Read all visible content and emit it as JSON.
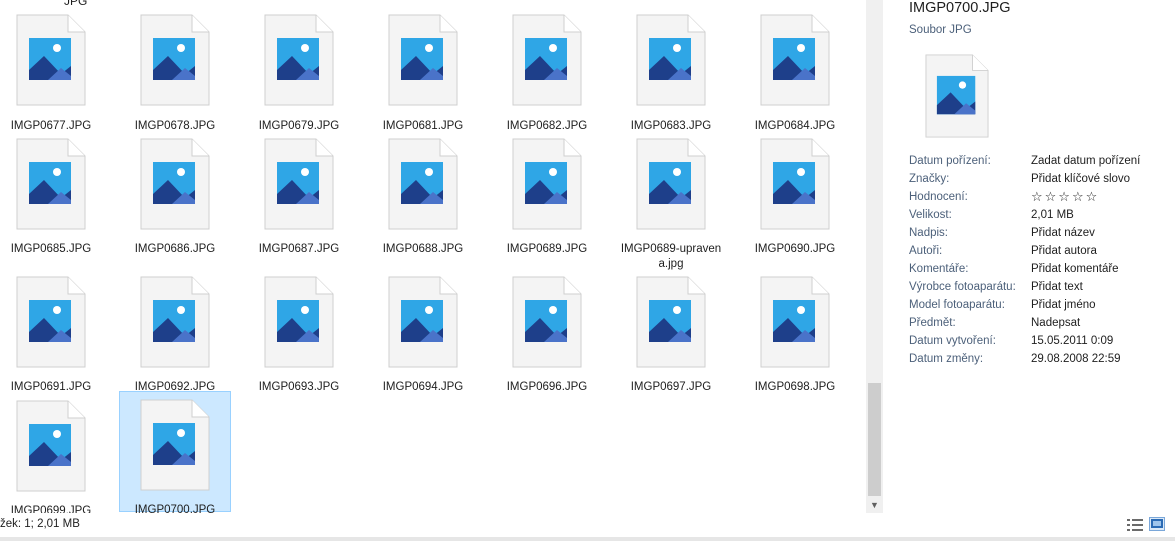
{
  "files": {
    "top_partial_label": "JPG",
    "items": [
      {
        "name": "IMGP0677.JPG",
        "selected": false
      },
      {
        "name": "IMGP0678.JPG",
        "selected": false
      },
      {
        "name": "IMGP0679.JPG",
        "selected": false
      },
      {
        "name": "IMGP0681.JPG",
        "selected": false
      },
      {
        "name": "IMGP0682.JPG",
        "selected": false
      },
      {
        "name": "IMGP0683.JPG",
        "selected": false
      },
      {
        "name": "IMGP0684.JPG",
        "selected": false
      },
      {
        "name": "IMGP0685.JPG",
        "selected": false
      },
      {
        "name": "IMGP0686.JPG",
        "selected": false
      },
      {
        "name": "IMGP0687.JPG",
        "selected": false
      },
      {
        "name": "IMGP0688.JPG",
        "selected": false
      },
      {
        "name": "IMGP0689.JPG",
        "selected": false
      },
      {
        "name": "IMGP0689-upravena.jpg",
        "selected": false
      },
      {
        "name": "IMGP0690.JPG",
        "selected": false
      },
      {
        "name": "IMGP0691.JPG",
        "selected": false
      },
      {
        "name": "IMGP0692.JPG",
        "selected": false
      },
      {
        "name": "IMGP0693.JPG",
        "selected": false
      },
      {
        "name": "IMGP0694.JPG",
        "selected": false
      },
      {
        "name": "IMGP0696.JPG",
        "selected": false
      },
      {
        "name": "IMGP0697.JPG",
        "selected": false
      },
      {
        "name": "IMGP0698.JPG",
        "selected": false
      },
      {
        "name": "IMGP0699.JPG",
        "selected": false
      },
      {
        "name": "IMGP0700.JPG",
        "selected": true
      }
    ]
  },
  "details": {
    "title": "IMGP0700.JPG",
    "type": "Soubor JPG",
    "properties": [
      {
        "key": "Datum pořízení:",
        "value": "Zadat datum pořízení"
      },
      {
        "key": "Značky:",
        "value": "Přidat klíčové slovo"
      },
      {
        "key": "Hodnocení:",
        "value": "☆☆☆☆☆"
      },
      {
        "key": "Velikost:",
        "value": "2,01 MB"
      },
      {
        "key": "Nadpis:",
        "value": "Přidat název"
      },
      {
        "key": "Autoři:",
        "value": "Přidat autora"
      },
      {
        "key": "Komentáře:",
        "value": "Přidat komentáře"
      },
      {
        "key": "Výrobce fotoaparátu:",
        "value": "Přidat text"
      },
      {
        "key": "Model fotoaparátu:",
        "value": "Přidat jméno"
      },
      {
        "key": "Předmět:",
        "value": "Nadepsat"
      },
      {
        "key": "Datum vytvoření:",
        "value": "15.05.2011 0:09"
      },
      {
        "key": "Datum změny:",
        "value": "29.08.2008 22:59"
      }
    ]
  },
  "status": {
    "text": "žek: 1; 2,01 MB"
  },
  "colors": {
    "selection_bg": "#cce8ff",
    "selection_border": "#99d1ff",
    "label": "#4c607a"
  }
}
